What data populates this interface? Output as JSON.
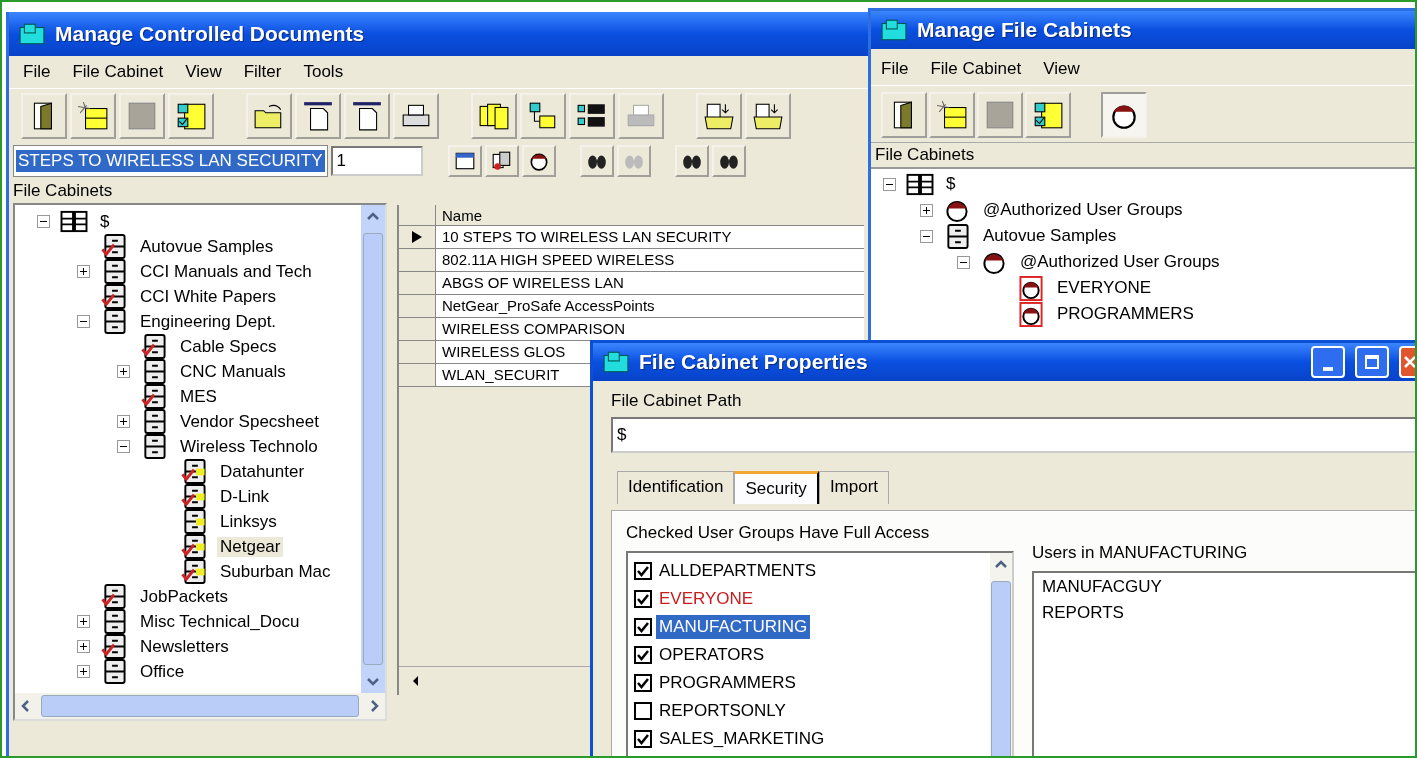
{
  "left_window": {
    "title": "Manage Controlled Documents",
    "menu": [
      "File",
      "File Cabinet",
      "View",
      "Filter",
      "Tools"
    ],
    "search": {
      "value": "STEPS TO WIRELESS LAN SECURITY"
    },
    "page_field": {
      "value": "1"
    },
    "tree_label": "File Cabinets",
    "tree": [
      {
        "label": "$",
        "kind": "root",
        "expanded": true,
        "selected": false,
        "children": [
          {
            "label": "Autovue Samples",
            "kind": "cabinet",
            "secured": true,
            "selected": false
          },
          {
            "label": "CCI Manuals and Tech",
            "kind": "cabinet",
            "secured": false,
            "expanded": false,
            "selected": false
          },
          {
            "label": "CCI White Papers",
            "kind": "cabinet",
            "secured": true,
            "selected": false
          },
          {
            "label": "Engineering Dept.",
            "kind": "cabinet",
            "secured": false,
            "expanded": true,
            "selected": false,
            "children": [
              {
                "label": "Cable Specs",
                "kind": "cabinet",
                "secured": true,
                "selected": false
              },
              {
                "label": "CNC Manuals",
                "kind": "cabinet",
                "secured": false,
                "expanded": false,
                "selected": false
              },
              {
                "label": "MES",
                "kind": "cabinet",
                "secured": true,
                "selected": false
              },
              {
                "label": "Vendor Specsheet",
                "kind": "cabinet",
                "secured": false,
                "expanded": false,
                "selected": false
              },
              {
                "label": "Wireless Technolo",
                "kind": "cabinet",
                "secured": false,
                "expanded": true,
                "selected": false,
                "children": [
                  {
                    "label": "Datahunter",
                    "kind": "tagged_cabinet",
                    "secured": true,
                    "selected": false
                  },
                  {
                    "label": "D-Link",
                    "kind": "tagged_cabinet",
                    "secured": true,
                    "selected": false
                  },
                  {
                    "label": "Linksys",
                    "kind": "tagged_cabinet",
                    "secured": false,
                    "selected": false
                  },
                  {
                    "label": "Netgear",
                    "kind": "tagged_cabinet",
                    "secured": true,
                    "selected": true
                  },
                  {
                    "label": "Suburban Mac",
                    "kind": "tagged_cabinet",
                    "secured": true,
                    "selected": false
                  }
                ]
              }
            ]
          },
          {
            "label": "JobPackets",
            "kind": "cabinet",
            "secured": true,
            "selected": false
          },
          {
            "label": "Misc Technical_Docu",
            "kind": "cabinet",
            "secured": false,
            "expanded": false,
            "selected": false
          },
          {
            "label": "Newsletters",
            "kind": "cabinet",
            "secured": true,
            "expanded": false,
            "selected": false
          },
          {
            "label": "Office",
            "kind": "cabinet",
            "secured": false,
            "expanded": false,
            "selected": false
          }
        ]
      }
    ],
    "table": {
      "columns": [
        "Name"
      ],
      "rows": [
        {
          "name": "10 STEPS TO WIRELESS LAN SECURITY",
          "selected": true
        },
        {
          "name": "802.11A HIGH SPEED WIRELESS",
          "selected": false
        },
        {
          "name": "ABGS OF WIRELESS LAN",
          "selected": false
        },
        {
          "name": "NetGear_ProSafe AccessPoints",
          "selected": false
        },
        {
          "name": "WIRELESS COMPARISON",
          "selected": false
        },
        {
          "name": "WIRELESS GLOS",
          "selected": false
        },
        {
          "name": "WLAN_SECURIT",
          "selected": false
        }
      ]
    }
  },
  "right_window": {
    "title": "Manage File Cabinets",
    "menu": [
      "File",
      "File Cabinet",
      "View"
    ],
    "tree_label": "File Cabinets",
    "tree": [
      {
        "label": "$",
        "kind": "root",
        "expanded": true,
        "children": [
          {
            "label": "@Authorized User Groups",
            "kind": "group",
            "expanded": false
          },
          {
            "label": "Autovue Samples",
            "kind": "cabinet",
            "expanded": true,
            "children": [
              {
                "label": "@Authorized User Groups",
                "kind": "group",
                "expanded": true,
                "children": [
                  {
                    "label": "EVERYONE",
                    "kind": "user_group"
                  },
                  {
                    "label": "PROGRAMMERS",
                    "kind": "user_group"
                  }
                ]
              }
            ]
          }
        ]
      }
    ]
  },
  "dialog": {
    "title": "File Cabinet Properties",
    "path_label": "File Cabinet Path",
    "path_field": {
      "value": "$"
    },
    "tabs": [
      {
        "label": "Identification",
        "selected": false
      },
      {
        "label": "Security",
        "selected": true
      },
      {
        "label": "Import",
        "selected": false
      }
    ],
    "groups_label": "Checked User Groups Have Full Access",
    "groups": [
      {
        "label": "ALLDEPARTMENTS",
        "checked": true,
        "selected": false,
        "highlighted": false
      },
      {
        "label": "EVERYONE",
        "checked": true,
        "selected": false,
        "highlighted": true
      },
      {
        "label": "MANUFACTURING",
        "checked": true,
        "selected": true,
        "highlighted": false
      },
      {
        "label": "OPERATORS",
        "checked": true,
        "selected": false,
        "highlighted": false
      },
      {
        "label": "PROGRAMMERS",
        "checked": true,
        "selected": false,
        "highlighted": false
      },
      {
        "label": "REPORTSONLY",
        "checked": false,
        "selected": false,
        "highlighted": false
      },
      {
        "label": "SALES_MARKETING",
        "checked": true,
        "selected": false,
        "highlighted": false
      }
    ],
    "users_label": "Users in MANUFACTURING",
    "users": [
      "MANUFACGUY",
      "REPORTS"
    ]
  }
}
